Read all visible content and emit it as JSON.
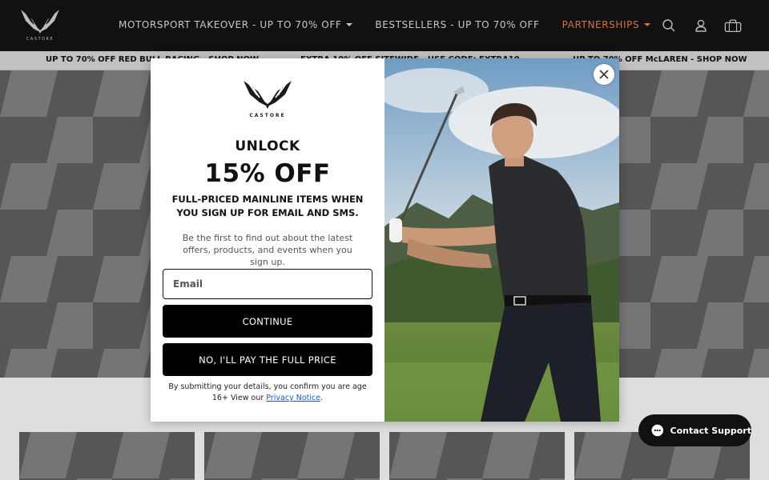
{
  "brand": {
    "name": "CASTORE"
  },
  "nav": {
    "items": [
      {
        "label": "MOTORSPORT TAKEOVER - UP TO 70% OFF",
        "has_dropdown": true
      },
      {
        "label": "BESTSELLERS - UP TO 70% OFF",
        "has_dropdown": false
      },
      {
        "label": "PARTNERSHIPS",
        "has_dropdown": true,
        "color": "#d8703a"
      }
    ]
  },
  "header_icons": [
    "search-icon",
    "account-icon",
    "bag-icon"
  ],
  "promo": {
    "items": [
      "UP TO 70% OFF RED BULL RACING - SHOP NOW",
      "EXTRA 10% OFF SITEWIDE - USE CODE: EXTRA10",
      "UP TO 70% OFF McLAREN - SHOP NOW"
    ]
  },
  "modal": {
    "brand": "CASTORE",
    "headline": "UNLOCK",
    "offer": "15% OFF",
    "subhead": "FULL-PRICED MAINLINE ITEMS WHEN YOU SIGN UP FOR EMAIL AND SMS.",
    "body": "Be the first to find out about the latest offers, products, and events when you sign up.",
    "email_placeholder": "Email",
    "email_value": "",
    "continue_label": "CONTINUE",
    "decline_label": "NO, I'LL PAY THE FULL PRICE",
    "legal_text": "By submitting your details, you confirm you are age 16+ View our",
    "privacy_link": "Privacy Notice",
    "legal_end": "."
  },
  "support": {
    "label": "Contact Support"
  },
  "colors": {
    "accent": "#d8703a",
    "header_bg": "#111111",
    "link": "#1a5ad7"
  }
}
